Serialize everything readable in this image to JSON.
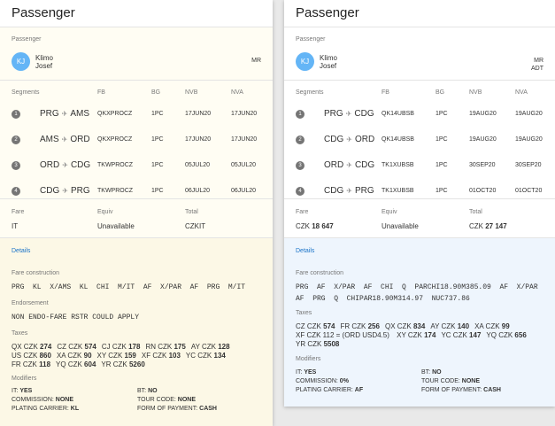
{
  "left": {
    "title": "Passenger",
    "passenger_label": "Passenger",
    "initials": "KJ",
    "last_name": "Klimo",
    "first_name": "Josef",
    "type": "MR",
    "type2": "",
    "seg_headers": {
      "segments": "Segments",
      "fb": "FB",
      "bg": "BG",
      "nvb": "NVB",
      "nva": "NVA"
    },
    "segments": [
      {
        "n": "1",
        "from": "PRG",
        "to": "AMS",
        "fb": "QKXPROCZ",
        "bg": "1PC",
        "nvb": "17JUN20",
        "nva": "17JUN20"
      },
      {
        "n": "2",
        "from": "AMS",
        "to": "ORD",
        "fb": "QKXPROCZ",
        "bg": "1PC",
        "nvb": "17JUN20",
        "nva": "17JUN20"
      },
      {
        "n": "3",
        "from": "ORD",
        "to": "CDG",
        "fb": "TKWPROCZ",
        "bg": "1PC",
        "nvb": "05JUL20",
        "nva": "05JUL20"
      },
      {
        "n": "4",
        "from": "CDG",
        "to": "PRG",
        "fb": "TKWPROCZ",
        "bg": "1PC",
        "nvb": "06JUL20",
        "nva": "06JUL20"
      }
    ],
    "fare": {
      "fare_label": "Fare",
      "equiv_label": "Equiv",
      "total_label": "Total",
      "fare_cur": "IT",
      "fare_amt": "",
      "equiv": "Unavailable",
      "total_cur": "CZKIT",
      "total_amt": ""
    },
    "details_label": "Details",
    "fc_label": "Fare construction",
    "fc_text": "PRG  KL  X/AMS  KL  CHI  M/IT  AF  X/PAR  AF  PRG  M/IT",
    "endorse_label": "Endorsement",
    "endorse_text": "NON ENDO-FARE RSTR COULD APPLY",
    "taxes_label": "Taxes",
    "taxes_lines": [
      [
        {
          "c": "QX CZK",
          "v": "274"
        },
        {
          "c": "CZ CZK",
          "v": "574"
        },
        {
          "c": "CJ CZK",
          "v": "178"
        },
        {
          "c": "RN CZK",
          "v": "175"
        },
        {
          "c": "AY CZK",
          "v": "128"
        }
      ],
      [
        {
          "c": "US CZK",
          "v": "860"
        },
        {
          "c": "XA CZK",
          "v": "90"
        },
        {
          "c": "XY CZK",
          "v": "159"
        },
        {
          "c": "XF CZK",
          "v": "103"
        },
        {
          "c": "YC CZK",
          "v": "134"
        }
      ],
      [
        {
          "c": "FR CZK",
          "v": "118"
        },
        {
          "c": "YQ CZK",
          "v": "604"
        },
        {
          "c": "YR CZK",
          "v": "5260"
        }
      ]
    ],
    "modifiers_label": "Modifiers",
    "mods": {
      "it_k": "IT:",
      "it_v": "YES",
      "bt_k": "BT:",
      "bt_v": "NO",
      "comm_k": "COMMISSION:",
      "comm_v": "NONE",
      "tour_k": "TOUR CODE:",
      "tour_v": "NONE",
      "pc_k": "PLATING CARRIER:",
      "pc_v": "KL",
      "fop_k": "FORM OF PAYMENT:",
      "fop_v": "CASH"
    }
  },
  "right": {
    "title": "Passenger",
    "passenger_label": "Passenger",
    "initials": "KJ",
    "last_name": "Klimo",
    "first_name": "Josef",
    "type": "MR",
    "type2": "ADT",
    "seg_headers": {
      "segments": "Segments",
      "fb": "FB",
      "bg": "BG",
      "nvb": "NVB",
      "nva": "NVA"
    },
    "segments": [
      {
        "n": "1",
        "from": "PRG",
        "to": "CDG",
        "fb": "QK14UBSB",
        "bg": "1PC",
        "nvb": "19AUG20",
        "nva": "19AUG20"
      },
      {
        "n": "2",
        "from": "CDG",
        "to": "ORD",
        "fb": "QK14UBSB",
        "bg": "1PC",
        "nvb": "19AUG20",
        "nva": "19AUG20"
      },
      {
        "n": "3",
        "from": "ORD",
        "to": "CDG",
        "fb": "TK1XUBSB",
        "bg": "1PC",
        "nvb": "30SEP20",
        "nva": "30SEP20"
      },
      {
        "n": "4",
        "from": "CDG",
        "to": "PRG",
        "fb": "TK1XUBSB",
        "bg": "1PC",
        "nvb": "01OCT20",
        "nva": "01OCT20"
      }
    ],
    "fare": {
      "fare_label": "Fare",
      "equiv_label": "Equiv",
      "total_label": "Total",
      "fare_cur": "CZK",
      "fare_amt": "18 647",
      "equiv": "Unavailable",
      "total_cur": "CZK",
      "total_amt": "27 147"
    },
    "details_label": "Details",
    "fc_label": "Fare construction",
    "fc_text": "PRG  AF  X/PAR  AF  CHI  Q  PARCHI18.90M385.09  AF  X/PAR\nAF  PRG  Q  CHIPAR18.90M314.97  NUC737.86",
    "taxes_label": "Taxes",
    "taxes_lines": [
      [
        {
          "c": "CZ CZK",
          "v": "574"
        },
        {
          "c": "FR CZK",
          "v": "256"
        },
        {
          "c": "QX CZK",
          "v": "834"
        },
        {
          "c": "AY CZK",
          "v": "140"
        },
        {
          "c": "XA CZK",
          "v": "99"
        }
      ],
      [
        {
          "c": "XF CZK 112 = (ORD USD4.5)",
          "v": ""
        },
        {
          "c": "XY CZK",
          "v": "174"
        },
        {
          "c": "YC CZK",
          "v": "147"
        },
        {
          "c": "YQ CZK",
          "v": "656"
        }
      ],
      [
        {
          "c": "YR CZK",
          "v": "5508"
        }
      ]
    ],
    "modifiers_label": "Modifiers",
    "mods": {
      "it_k": "IT:",
      "it_v": "YES",
      "bt_k": "BT:",
      "bt_v": "NO",
      "comm_k": "COMMISSION:",
      "comm_v": "0%",
      "tour_k": "TOUR CODE:",
      "tour_v": "NONE",
      "pc_k": "PLATING CARRIER:",
      "pc_v": "AF",
      "fop_k": "FORM OF PAYMENT:",
      "fop_v": "CASH"
    }
  }
}
